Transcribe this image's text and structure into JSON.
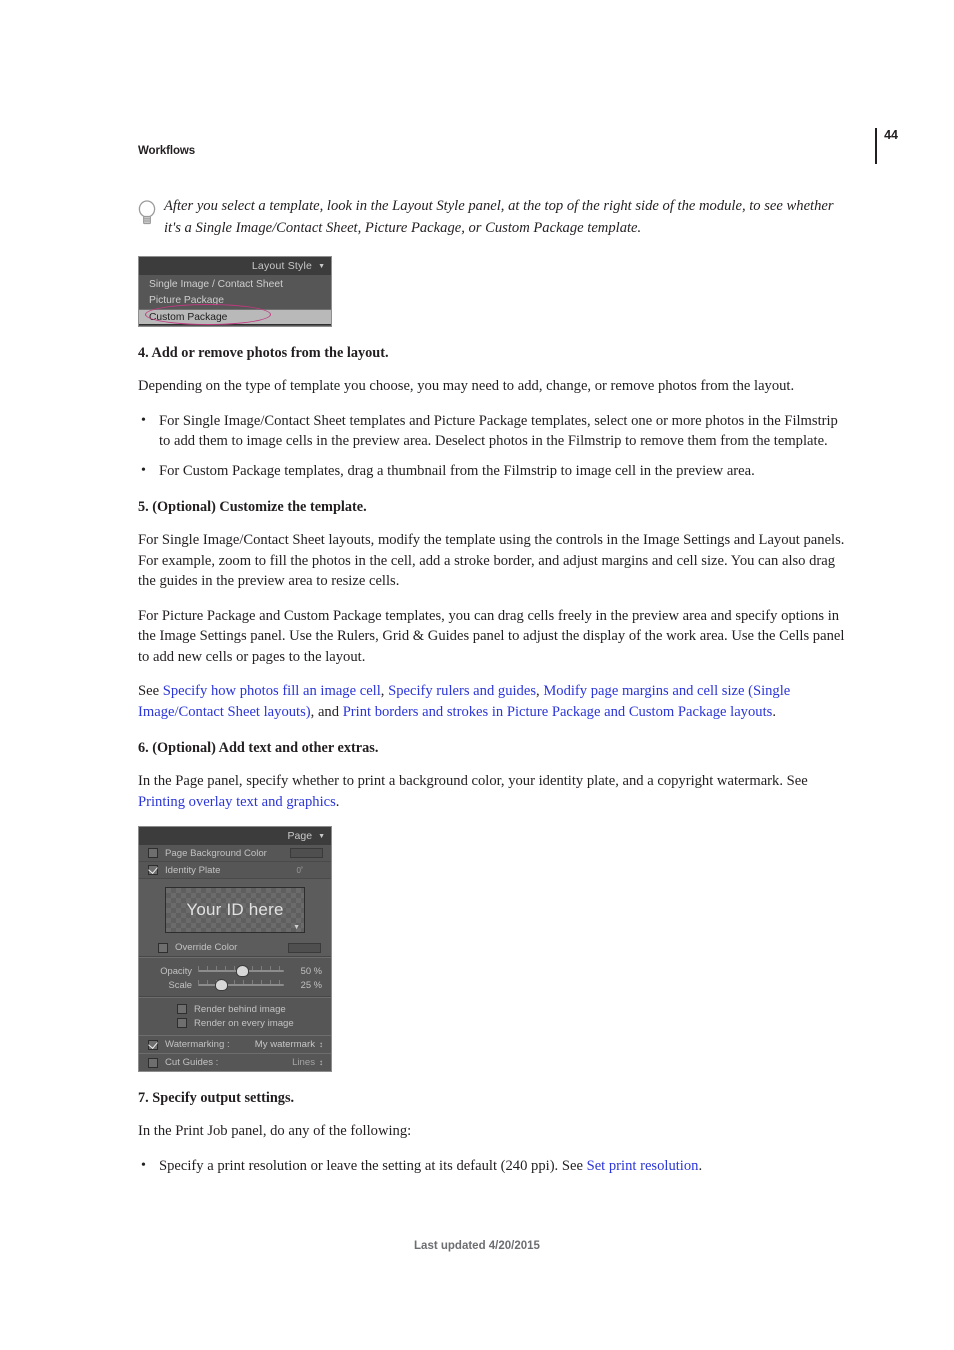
{
  "header": {
    "section_title": "Workflows",
    "page_number": "44"
  },
  "tip_note": {
    "icon": "lightbulb-icon",
    "text": "After you select a template, look in the Layout Style panel, at the top of the right side of the module, to see whether it's a Single Image/Contact Sheet, Picture Package, or Custom Package template."
  },
  "layout_style_panel": {
    "title": "Layout Style",
    "caret": "▼",
    "options": [
      "Single Image / Contact Sheet",
      "Picture Package",
      "Custom Package"
    ],
    "selected_option": "Custom Package",
    "annotation_color": "#c0397f"
  },
  "steps": {
    "step4": {
      "heading": "4. Add or remove photos from the layout.",
      "paragraph": "Depending on the type of template you choose, you may need to add, change, or remove photos from the layout.",
      "bullets": [
        "For Single Image/Contact Sheet templates and Picture Package templates, select one or more photos in the Filmstrip to add them to image cells in the preview area. Deselect photos in the Filmstrip to remove them from the template.",
        "For Custom Package templates, drag a thumbnail from the Filmstrip to image cell in the preview area."
      ]
    },
    "step5": {
      "heading": "5. (Optional) Customize the template.",
      "paragraph1": "For Single Image/Contact Sheet layouts, modify the template using the controls in the Image Settings and Layout panels. For example, zoom to fill the photos in the cell, add a stroke border, and adjust margins and cell size. You can also drag the guides in the preview area to resize cells.",
      "paragraph2": "For Picture Package and Custom Package templates, you can drag cells freely in the preview area and specify options in the Image Settings panel. Use the Rulers, Grid & Guides panel to adjust the display of the work area. Use the Cells panel to add new cells or pages to the layout.",
      "see_prefix": "See ",
      "links": [
        "Specify how photos fill an image cell",
        "Specify rulers and guides",
        "Modify page margins and cell size (Single Image/Contact Sheet layouts)",
        "Print borders and strokes in Picture Package and Custom Package layouts"
      ],
      "sep1": ", ",
      "sep2": ", ",
      "sep3": ", and ",
      "period": "."
    },
    "step6": {
      "heading": "6. (Optional) Add text and other extras.",
      "paragraph_prefix": "In the Page panel, specify whether to print a background color, your identity plate, and a copyright watermark. See ",
      "link": "Printing overlay text and graphics",
      "paragraph_suffix": "."
    },
    "step7": {
      "heading": "7. Specify output settings.",
      "paragraph": "In the Print Job panel, do any of the following:",
      "bullet_prefix": "Specify a print resolution or leave the setting at its default (240 ppi). See ",
      "bullet_link": "Set print resolution",
      "bullet_suffix": "."
    }
  },
  "page_panel": {
    "title": "Page",
    "caret": "▼",
    "page_background_color": {
      "label": "Page Background Color",
      "checked": false
    },
    "identity_plate": {
      "label": "Identity Plate",
      "checked": true,
      "rotation": "0˚",
      "preview_text": "Your ID here",
      "preview_caret": "▼"
    },
    "override_color": {
      "label": "Override Color",
      "checked": false
    },
    "sliders": [
      {
        "label": "Opacity",
        "value": "50",
        "unit": "%",
        "percent": 50
      },
      {
        "label": "Scale",
        "value": "25",
        "unit": "%",
        "percent": 25
      }
    ],
    "render_options": [
      {
        "label": "Render behind image",
        "checked": false
      },
      {
        "label": "Render on every image",
        "checked": false
      }
    ],
    "watermarking": {
      "label": "Watermarking :",
      "checked": true,
      "value": "My watermark",
      "stepper": "↕"
    },
    "cut_guides": {
      "label": "Cut Guides :",
      "checked": false,
      "value": "Lines",
      "stepper": "↕"
    }
  },
  "footer": {
    "text": "Last updated 4/20/2015"
  }
}
